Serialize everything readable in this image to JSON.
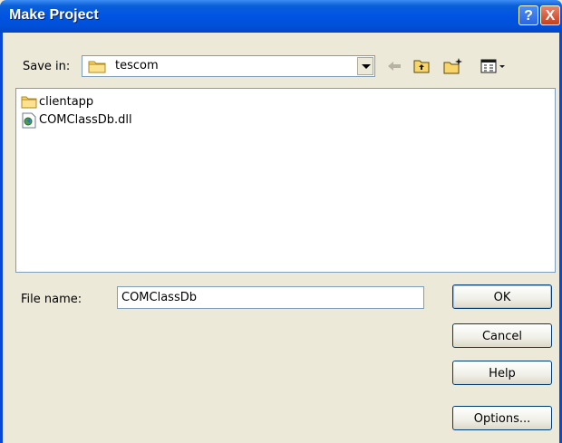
{
  "window": {
    "title": "Make Project",
    "help_glyph": "?",
    "close_glyph": "X"
  },
  "savein": {
    "label": "Save in:",
    "value": "tescom"
  },
  "files": [
    {
      "name": "clientapp",
      "icon": "folder-icon"
    },
    {
      "name": "COMClassDb.dll",
      "icon": "dll-file-icon"
    }
  ],
  "filename": {
    "label": "File name:",
    "value": "COMClassDb"
  },
  "buttons": {
    "ok": "OK",
    "cancel": "Cancel",
    "help": "Help",
    "options": "Options..."
  },
  "colors": {
    "titlebar": "#0054e3",
    "dialog_bg": "#ece9d8",
    "border": "#7f9db9"
  }
}
